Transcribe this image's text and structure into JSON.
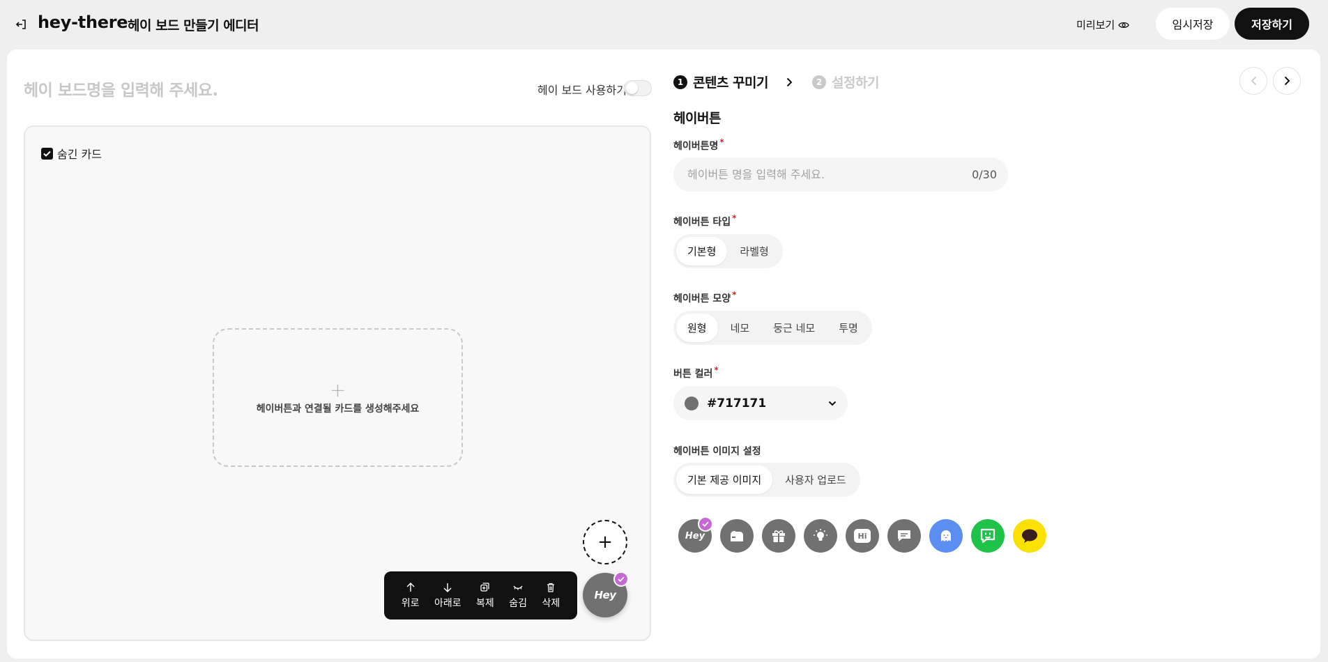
{
  "header": {
    "brand": "hey-there",
    "editor_title": "헤이 보드 만들기 에디터",
    "preview_label": "미리보기",
    "temp_save_label": "임시저장",
    "save_label": "저장하기"
  },
  "board": {
    "name_placeholder": "헤이 보드명을 입력해 주세요.",
    "use_label": "헤이 보드 사용하기",
    "hidden_card_label": "숨긴 카드",
    "add_card_text": "헤이버튼과 연결될 카드를 생성해주세요"
  },
  "toolbar": {
    "items": [
      {
        "label": "위로",
        "icon": "arrow-up-icon"
      },
      {
        "label": "아래로",
        "icon": "arrow-down-icon"
      },
      {
        "label": "복제",
        "icon": "duplicate-icon"
      },
      {
        "label": "숨김",
        "icon": "hide-icon"
      },
      {
        "label": "삭제",
        "icon": "trash-icon"
      }
    ]
  },
  "hey_fab": {
    "word": "Hey"
  },
  "steps": [
    {
      "num": "1",
      "label": "콘텐츠 꾸미기",
      "active": true
    },
    {
      "num": "2",
      "label": "설정하기",
      "active": false
    }
  ],
  "form": {
    "section_title": "헤이버튼",
    "name_label": "헤이버튼명",
    "name_placeholder": "헤이버튼 명을 입력해 주세요.",
    "name_counter": "0/30",
    "type_label": "헤이버튼 타입",
    "type_options": [
      "기본형",
      "라벨형"
    ],
    "shape_label": "헤이버튼 모양",
    "shape_options": [
      "원형",
      "네모",
      "둥근 네모",
      "투명"
    ],
    "color_label": "버튼 컬러",
    "color_value": "#717171",
    "image_label": "헤이버튼 이미지 설정",
    "image_options": [
      "기본 제공 이미지",
      "사용자 업로드"
    ]
  },
  "icon_presets": [
    {
      "name": "hey-text-icon",
      "bg": "#717171",
      "selected": true,
      "text": "Hey"
    },
    {
      "name": "mailbox-icon",
      "bg": "#717171"
    },
    {
      "name": "gift-icon",
      "bg": "#717171"
    },
    {
      "name": "lightbulb-icon",
      "bg": "#717171"
    },
    {
      "name": "hi-bubble-icon",
      "bg": "#717171",
      "text": "Hi"
    },
    {
      "name": "chat-bubble-icon",
      "bg": "#717171"
    },
    {
      "name": "ghost-icon",
      "bg": "#5b8ef0"
    },
    {
      "name": "line-talk-icon",
      "bg": "#1fc34a"
    },
    {
      "name": "kakao-talk-icon",
      "bg": "#fae100"
    }
  ],
  "colors": {
    "accent": "#111111",
    "badge": "#c56ad3",
    "required": "#e02020",
    "button_color": "#717171"
  }
}
